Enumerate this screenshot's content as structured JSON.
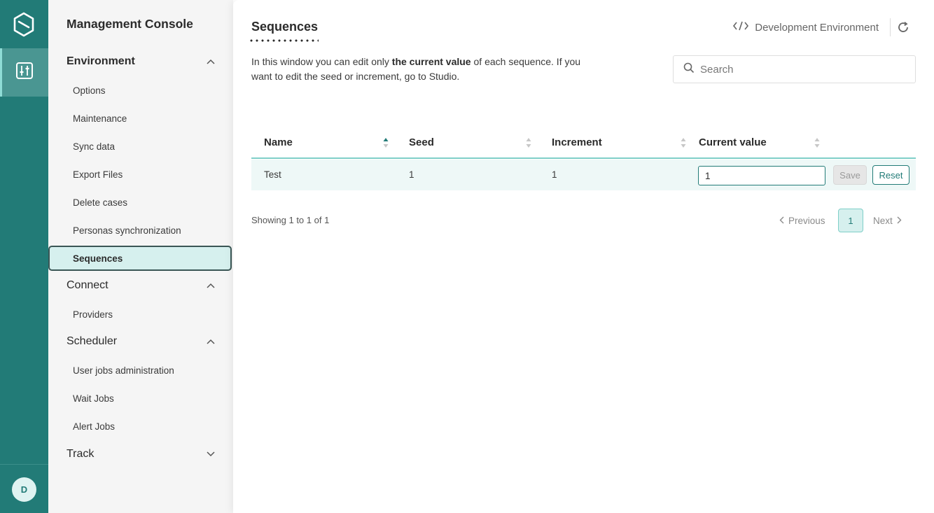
{
  "rail": {
    "logo_icon": "hexagon-logo-icon",
    "active_item_icon": "sliders-icon",
    "avatar_initial": "D"
  },
  "sidebar": {
    "title": "Management Console",
    "groups": [
      {
        "label": "Environment",
        "expanded": true,
        "items": [
          "Options",
          "Maintenance",
          "Sync data",
          "Export Files",
          "Delete cases",
          "Personas synchronization",
          "Sequences"
        ]
      },
      {
        "label": "Connect",
        "expanded": true,
        "items": [
          "Providers"
        ]
      },
      {
        "label": "Scheduler",
        "expanded": true,
        "items": [
          "User jobs administration",
          "Wait Jobs",
          "Alert Jobs"
        ]
      },
      {
        "label": "Track",
        "expanded": false,
        "items": []
      }
    ],
    "active_item": "Sequences"
  },
  "main": {
    "title": "Sequences",
    "environment": "Development Environment",
    "description": {
      "part1": "In this window you can edit only ",
      "bold": "the current value",
      "part2": " of each sequence. If you want to edit the seed or increment, go to Studio."
    },
    "search": {
      "placeholder": "Search",
      "value": ""
    },
    "table": {
      "columns": [
        "Name",
        "Seed",
        "Increment",
        "Current value"
      ],
      "rows": [
        {
          "name": "Test",
          "seed": "1",
          "increment": "1",
          "current_value": "1"
        }
      ],
      "save_label": "Save",
      "reset_label": "Reset"
    },
    "pagination": {
      "showing": "Showing 1 to 1 of 1",
      "previous": "Previous",
      "current_page": "1",
      "next": "Next"
    }
  },
  "colors": {
    "rail": "#227b77",
    "accent": "#227b77",
    "accent_light": "#d6f0ee",
    "sidebar_bg": "#f5f5f5"
  }
}
